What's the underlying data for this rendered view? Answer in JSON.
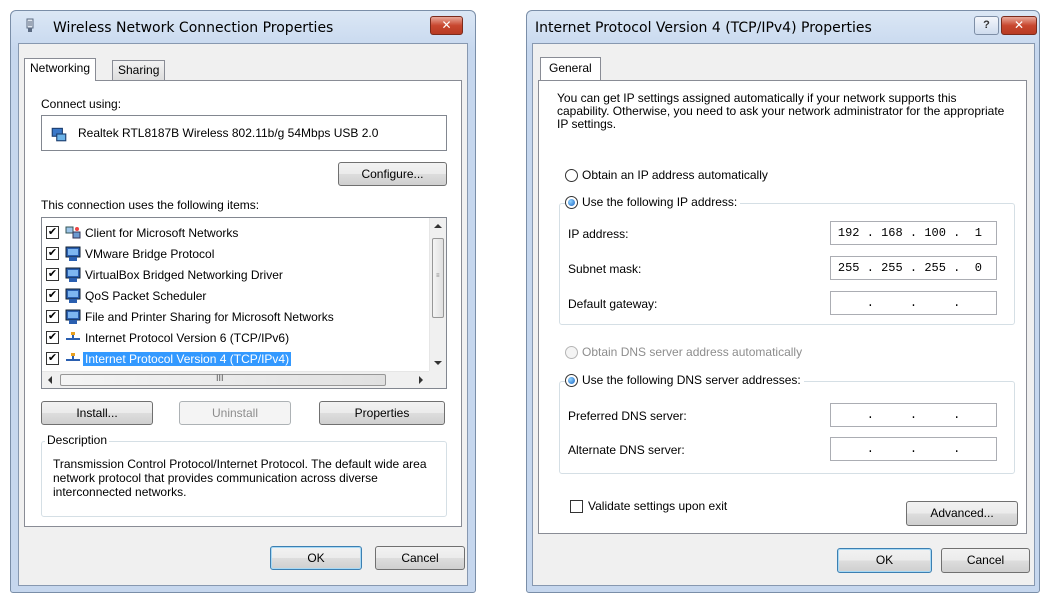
{
  "left_dialog": {
    "title": "Wireless Network Connection Properties",
    "close_label": "✕",
    "tabs": [
      "Networking",
      "Sharing"
    ],
    "connect_using_label": "Connect using:",
    "adapter_name": "Realtek RTL8187B Wireless 802.11b/g 54Mbps USB 2.0",
    "configure_label": "Configure...",
    "items_label": "This connection uses the following items:",
    "items": [
      {
        "label": "Client for Microsoft Networks",
        "checked": true,
        "icon": "network-client-icon"
      },
      {
        "label": "VMware Bridge Protocol",
        "checked": true,
        "icon": "protocol-icon"
      },
      {
        "label": "VirtualBox Bridged Networking Driver",
        "checked": true,
        "icon": "protocol-icon"
      },
      {
        "label": "QoS Packet Scheduler",
        "checked": true,
        "icon": "protocol-icon"
      },
      {
        "label": "File and Printer Sharing for Microsoft Networks",
        "checked": true,
        "icon": "protocol-icon"
      },
      {
        "label": "Internet Protocol Version 6 (TCP/IPv6)",
        "checked": true,
        "icon": "ip-protocol-icon"
      },
      {
        "label": "Internet Protocol Version 4 (TCP/IPv4)",
        "checked": true,
        "icon": "ip-protocol-icon",
        "selected": true
      }
    ],
    "scroll_grip": "III",
    "install_label": "Install...",
    "uninstall_label": "Uninstall",
    "properties_label": "Properties",
    "description_title": "Description",
    "description_text": "Transmission Control Protocol/Internet Protocol. The default wide area network protocol that provides communication across diverse interconnected networks.",
    "ok_label": "OK",
    "cancel_label": "Cancel"
  },
  "right_dialog": {
    "title": "Internet Protocol Version 4 (TCP/IPv4) Properties",
    "help_label": "?",
    "close_label": "✕",
    "tab_general": "General",
    "intro_text": "You can get IP settings assigned automatically if your network supports this capability. Otherwise, you need to ask your network administrator for the appropriate IP settings.",
    "obtain_ip_auto": "Obtain an IP address automatically",
    "use_following_ip": "Use the following IP address:",
    "ip_address_label": "IP address:",
    "ip_address": [
      "192",
      "168",
      "100",
      "1"
    ],
    "subnet_mask_label": "Subnet mask:",
    "subnet_mask": [
      "255",
      "255",
      "255",
      "0"
    ],
    "default_gateway_label": "Default gateway:",
    "default_gateway": [
      "",
      "",
      "",
      ""
    ],
    "obtain_dns_auto": "Obtain DNS server address automatically",
    "use_following_dns": "Use the following DNS server addresses:",
    "preferred_dns_label": "Preferred DNS server:",
    "preferred_dns": [
      "",
      "",
      "",
      ""
    ],
    "alternate_dns_label": "Alternate DNS server:",
    "alternate_dns": [
      "",
      "",
      "",
      ""
    ],
    "validate_label": "Validate settings upon exit",
    "advanced_label": "Advanced...",
    "ok_label": "OK",
    "cancel_label": "Cancel",
    "ip_separator": "."
  }
}
